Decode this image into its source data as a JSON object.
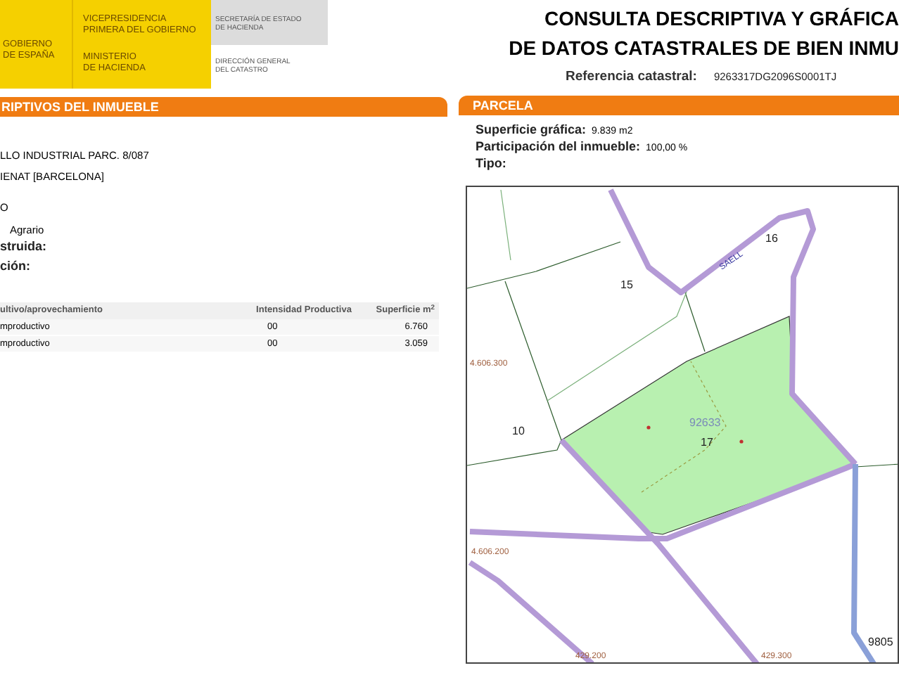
{
  "header": {
    "blocks": [
      {
        "kind": "crest",
        "lines": [
          "GOBIERNO",
          "DE ESPAÑA"
        ]
      },
      {
        "kind": "ministry",
        "lines": [
          "VICEPRESIDENCIA",
          "PRIMERA DEL GOBIERNO"
        ]
      },
      {
        "kind": "ministry",
        "lines": [
          "MINISTERIO",
          "DE HACIENDA"
        ]
      },
      {
        "kind": "office",
        "lines": [
          "SECRETARÍA DE ESTADO",
          "DE HACIENDA"
        ]
      },
      {
        "kind": "office-plain",
        "lines": [
          "DIRECCIÓN GENERAL",
          "DEL CATASTRO"
        ]
      }
    ]
  },
  "title_lines": [
    "CONSULTA DESCRIPTIVA Y GRÁFICA",
    "DE DATOS CATASTRALES DE BIEN INMU"
  ],
  "reference": {
    "label": "Referencia catastral:",
    "value": "9263317DG2096S0001TJ"
  },
  "property_section": {
    "title": "RIPTIVOS DEL INMUEBLE",
    "lines": [
      {
        "kind": "value",
        "text": "LLO INDUSTRIAL  PARC. 8/087"
      },
      {
        "kind": "value",
        "text": "IENAT [BARCELONA]"
      },
      {
        "kind": "value",
        "text": "O"
      },
      {
        "kind": "value",
        "text": "Agrario"
      },
      {
        "kind": "label",
        "text": "struida:"
      },
      {
        "kind": "label",
        "text": "ción:"
      }
    ],
    "table": {
      "columns": [
        "ultivo/aprovechamiento",
        "Intensidad Productiva",
        "Superficie m$^{2}$"
      ],
      "rows": [
        [
          "mproductivo",
          "00",
          "6.760"
        ],
        [
          "mproductivo",
          "00",
          "3.059"
        ]
      ]
    }
  },
  "parcel_section": {
    "title": "PARCELA",
    "fields": [
      {
        "label": "Superficie gráfica:",
        "value": "9.839 m2"
      },
      {
        "label": "Participación del inmueble:",
        "value": "100,00 %"
      },
      {
        "label": "Tipo:"
      }
    ],
    "map": {
      "labels": [
        {
          "kind": "parcel",
          "text": "15"
        },
        {
          "kind": "parcel",
          "text": "16"
        },
        {
          "kind": "parcel",
          "text": "17"
        },
        {
          "kind": "parcel",
          "text": "10"
        },
        {
          "kind": "block",
          "text": "92633"
        },
        {
          "kind": "street",
          "text": "SAELL"
        },
        {
          "kind": "coordinate",
          "text": "4.606.300"
        },
        {
          "kind": "coordinate",
          "text": "4.606.200"
        },
        {
          "kind": "coordinate",
          "text": "429.200"
        },
        {
          "kind": "coordinate",
          "text": "429.300"
        },
        {
          "kind": "parcel",
          "text": "9805"
        }
      ]
    }
  }
}
